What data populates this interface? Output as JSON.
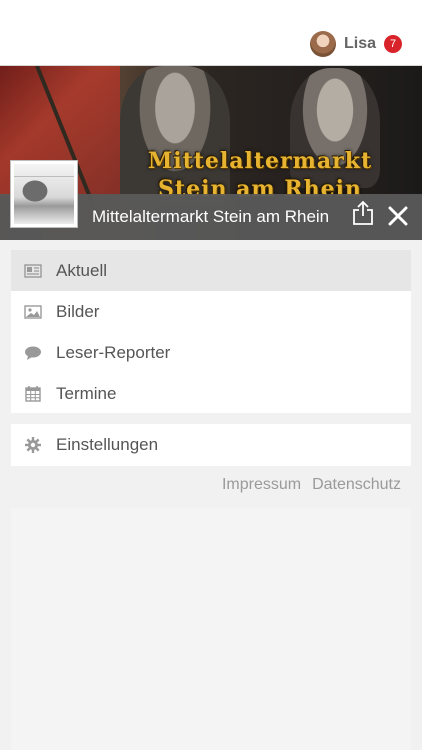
{
  "user": {
    "name": "Lisa",
    "notification_count": "7"
  },
  "hero": {
    "banner_line1": "Mittelaltermarkt",
    "banner_line2": "Stein am Rhein",
    "title": "Mittelaltermarkt Stein am Rhein",
    "share_icon": "share-icon",
    "close_icon": "close-icon"
  },
  "menu": {
    "items": [
      {
        "label": "Aktuell",
        "icon": "newspaper-icon",
        "active": true
      },
      {
        "label": "Bilder",
        "icon": "image-icon",
        "active": false
      },
      {
        "label": "Leser-Reporter",
        "icon": "speech-bubble-icon",
        "active": false
      },
      {
        "label": "Termine",
        "icon": "calendar-icon",
        "active": false
      }
    ],
    "settings": {
      "label": "Einstellungen",
      "icon": "gear-icon"
    }
  },
  "footer": {
    "impressum": "Impressum",
    "datenschutz": "Datenschutz"
  },
  "colors": {
    "badge": "#d9232a",
    "banner_text": "#e7b431",
    "bar": "#5a5a5a",
    "active_item": "#e6e6e6"
  }
}
